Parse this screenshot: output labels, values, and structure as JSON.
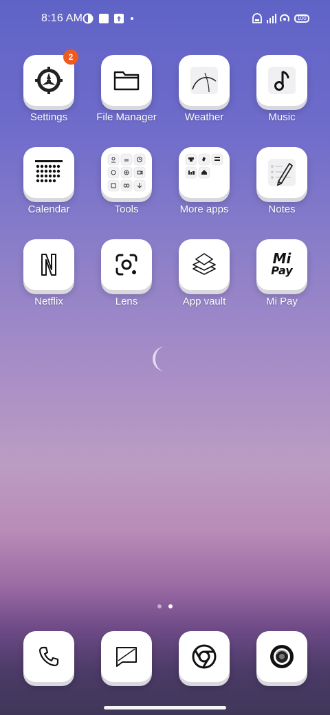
{
  "status_bar": {
    "time": "8:16 AM",
    "battery": "100"
  },
  "apps": [
    {
      "label": "Settings",
      "badge": "2",
      "icon": "settings-gear-icon"
    },
    {
      "label": "File Manager",
      "icon": "folder-icon"
    },
    {
      "label": "Weather",
      "icon": "weather-icon"
    },
    {
      "label": "Music",
      "icon": "music-note-icon"
    },
    {
      "label": "Calendar",
      "icon": "calendar-icon"
    },
    {
      "label": "Tools",
      "icon": "tools-folder-icon"
    },
    {
      "label": "More apps",
      "icon": "more-apps-folder-icon"
    },
    {
      "label": "Notes",
      "icon": "notes-icon"
    },
    {
      "label": "Netflix",
      "icon": "netflix-icon"
    },
    {
      "label": "Lens",
      "icon": "lens-icon"
    },
    {
      "label": "App vault",
      "icon": "app-vault-icon"
    },
    {
      "label": "Mi Pay",
      "icon": "mi-pay-icon",
      "icon_text_top": "Mi",
      "icon_text_bottom": "Pay"
    }
  ],
  "dock": [
    {
      "icon": "phone-icon"
    },
    {
      "icon": "messages-icon"
    },
    {
      "icon": "chrome-icon"
    },
    {
      "icon": "camera-icon"
    }
  ],
  "page_indicator": {
    "pages": 2,
    "current": 2
  }
}
